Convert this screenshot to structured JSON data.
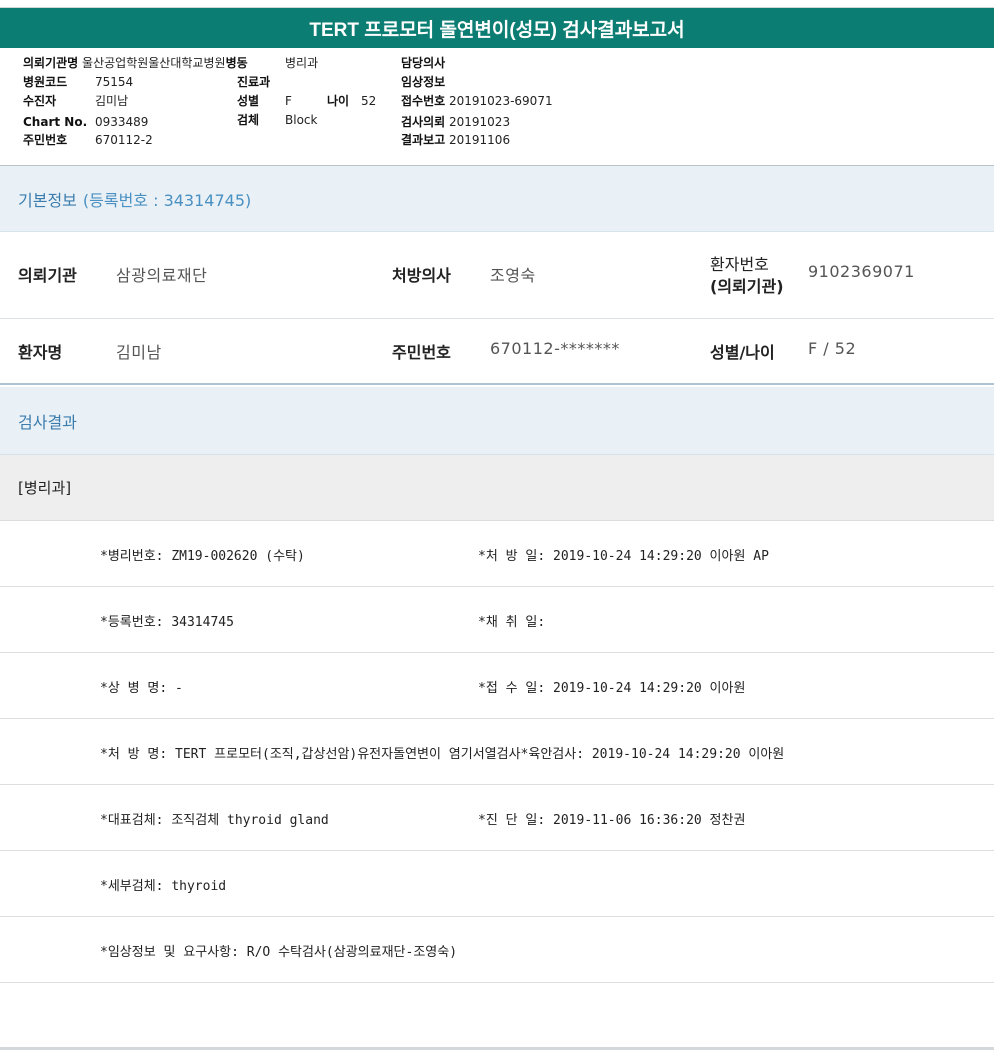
{
  "report": {
    "title": "TERT 프로모터 돌연변이(성모) 검사결과보고서"
  },
  "header": {
    "institution_label": "의뢰기관명",
    "institution": "울산공업학원울산대학교병원",
    "ward_label": "병동",
    "ward": "병리과",
    "doctor_label": "담당의사",
    "doctor": "",
    "hospital_code_label": "병원코드",
    "hospital_code": "75154",
    "dept_label": "진료과",
    "dept": "",
    "clinical_label": "임상정보",
    "clinical": "",
    "collector_label": "수진자",
    "collector": "김미남",
    "sex_label": "성별",
    "sex": "F",
    "age_label": "나이",
    "age": "52",
    "reception_label": "접수번호",
    "reception": "20191023-69071",
    "chart_label": "Chart No.",
    "chart": "0933489",
    "specimen_label": "검체",
    "specimen": "Block",
    "request_label": "검사의뢰",
    "request": "20191023",
    "rrn_label": "주민번호",
    "rrn": "670112-2",
    "report_label": "결과보고",
    "report_date": "20191106"
  },
  "basic_info": {
    "heading": "기본정보",
    "reg_text": "(등록번호 : 34314745)",
    "row1": {
      "inst_label": "의뢰기관",
      "inst_value": "삼광의료재단",
      "presc_label": "처방의사",
      "presc_value": "조영숙",
      "patno_label_1": "환자번호",
      "patno_label_2": "(의뢰기관)",
      "patno_value": "9102369071"
    },
    "row2": {
      "name_label": "환자명",
      "name_value": "김미남",
      "rrn_label": "주민번호",
      "rrn_value": "670112-*******",
      "sexage_label": "성별/나이",
      "sexage_value": "F / 52"
    }
  },
  "results": {
    "heading": "검사결과",
    "dept": "[병리과]",
    "rows": [
      {
        "left": "*병리번호: ZM19-002620 (수탁)",
        "right": "*처 방 일: 2019-10-24 14:29:20  이아원 AP"
      },
      {
        "left": "*등록번호: 34314745",
        "right": "*채 취 일:"
      },
      {
        "left": "*상 병 명: -",
        "right": "*접 수 일: 2019-10-24 14:29:20  이아원"
      },
      {
        "left": "*처 방 명: TERT 프로모터(조직,갑상선암)유전자돌연변이 염기서열검사*육안검사: 2019-10-24 14:29:20  이아원",
        "right": ""
      },
      {
        "left": "*대표검체: 조직검체 thyroid gland",
        "right": "*진 단 일: 2019-11-06 16:36:20  정찬권"
      },
      {
        "left": "*세부검체: thyroid",
        "right": ""
      },
      {
        "left": "*임상정보 및 요구사항: R/O 수탁검사(삼광의료재단-조영숙)",
        "right": ""
      }
    ]
  }
}
